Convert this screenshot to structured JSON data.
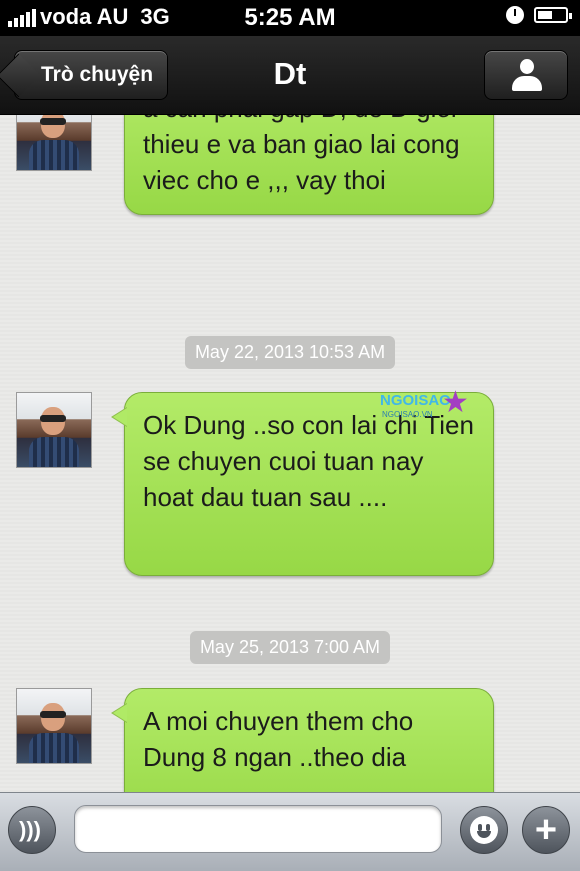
{
  "status_bar": {
    "carrier": "voda AU",
    "network": "3G",
    "time": "5:25 AM",
    "icons": [
      "signal-icon",
      "alarm-clock-icon",
      "battery-icon"
    ]
  },
  "nav": {
    "back_label": "Trò chuyện",
    "title": "Dt",
    "contact_icon": "person-icon"
  },
  "messages": [
    {
      "text": "a can phai gap D, de D gioi thieu e va ban giao lai cong viec cho e ,,, vay thoi"
    },
    {
      "text": "Ok Dung ..so con lai chi Tien se chuyen cuoi tuan nay hoat dau tuan sau ...."
    },
    {
      "text": "A moi chuyen them cho Dung 8 ngan ..theo dia"
    }
  ],
  "timestamps": [
    "May 22, 2013 10:53 AM",
    "May 25, 2013 7:00 AM"
  ],
  "watermark": {
    "title": "NGOISAO",
    "subtitle": "NGOISAO.VN"
  },
  "input_bar": {
    "placeholder": "",
    "icons": [
      "voice-icon",
      "emoji-icon",
      "plus-icon"
    ]
  },
  "colors": {
    "bubble": "#a6e258",
    "navbar": "#1c1c1c",
    "timestamp_bg": "#c4c4c2"
  }
}
